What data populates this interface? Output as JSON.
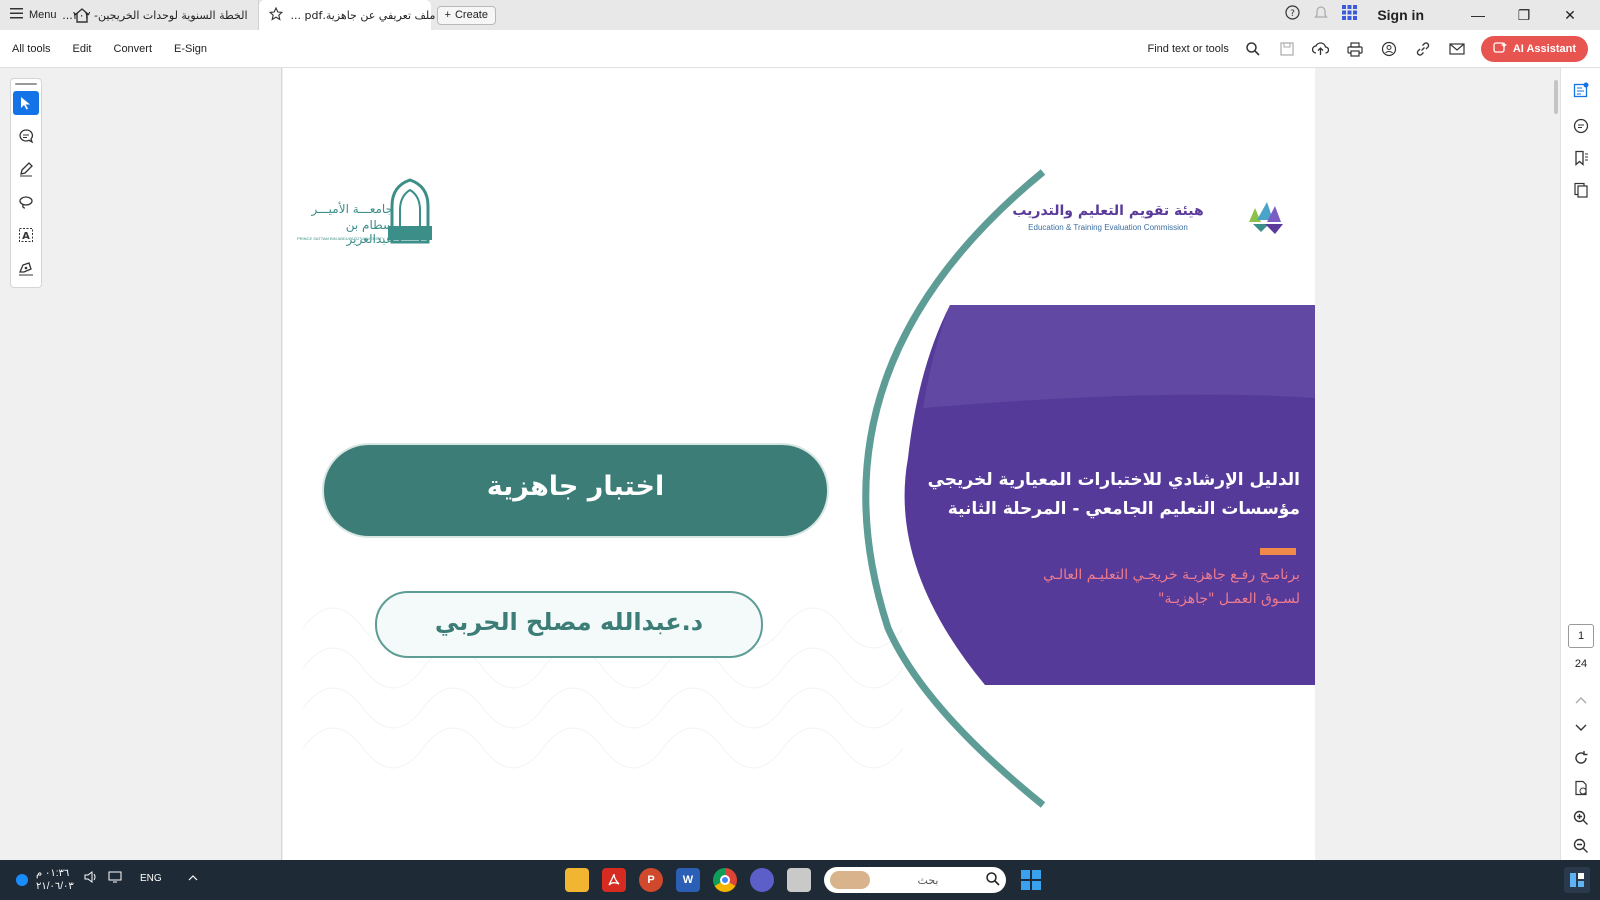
{
  "titlebar": {
    "menu_label": "Menu",
    "tabs": [
      {
        "label": "الخطة السنوية لوحدات الخريجين- ٢٠٢..."
      },
      {
        "label": "ملف تعريفي عن جاهزية.pdf ..."
      }
    ],
    "create_label": "Create",
    "signin_label": "Sign in"
  },
  "toolbar": {
    "menus": [
      "All tools",
      "Edit",
      "Convert",
      "E-Sign"
    ],
    "find_label": "Find text or tools",
    "ai_label": "AI Assistant"
  },
  "document": {
    "etec_name_ar": "هيئة تقويم التعليم والتدريب",
    "etec_name_en": "Education & Training Evaluation Commission",
    "university_ar_1": "جامعـــة الأميـــر",
    "university_ar_2": "سطام بن عبدالعزيز",
    "university_en": "PRINCE SATTAM BIN ABDULAZIZ UNIVERSITY",
    "main_title_line1": "الدليل الإرشادي للاختبارات المعيارية لخريجي",
    "main_title_line2": "مؤسسات التعليم الجامعي - المرحلة الثانية",
    "subtitle_line1": "برنامـج رفـع جاهزيـة خريجـي التعليـم العالـي",
    "subtitle_line2": "لسـوق العمـل \"جاهزيـة\"",
    "exam_button": "اختبار جاهزية",
    "author": "د.عبدالله مصلح الحربي"
  },
  "pager": {
    "current": "1",
    "total": "24"
  },
  "taskbar": {
    "time": "٠١:٣٦ م",
    "date": "٢١/٠٦/٠٣",
    "lang": "ENG",
    "search_placeholder": "بحث"
  },
  "colors": {
    "accent_blue": "#1473e6",
    "ai_red": "#e8544f",
    "teal": "#3d7d77",
    "purple": "#5a3a9a",
    "orange": "#f0894a",
    "pink_text": "#f07b8c"
  }
}
